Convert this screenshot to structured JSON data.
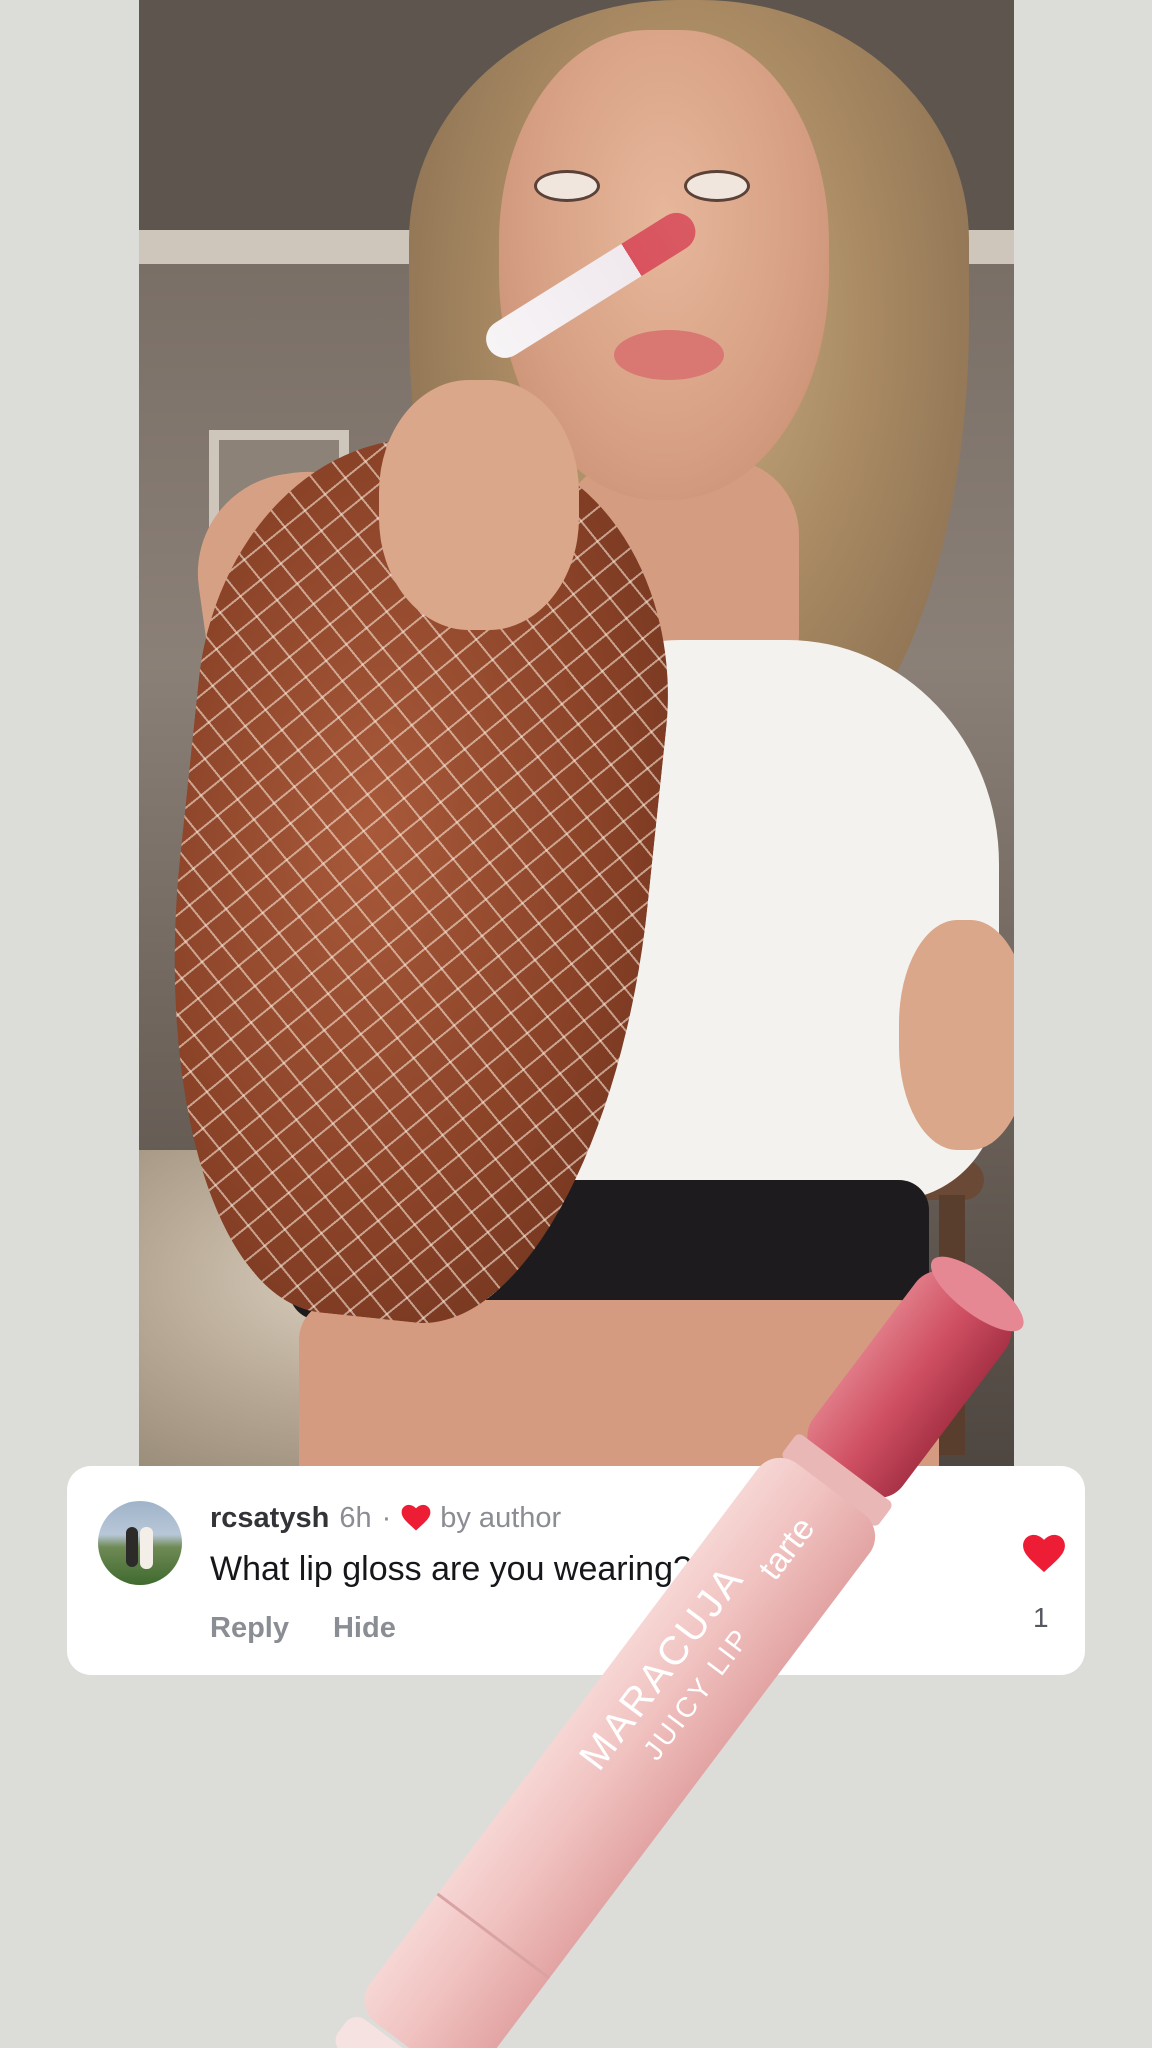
{
  "comment": {
    "username": "rcsatysh",
    "time": "6h",
    "separator": "·",
    "liked_by": "by author",
    "text": "What lip gloss are you wearing?",
    "reply_label": "Reply",
    "hide_label": "Hide",
    "like_count": "1"
  },
  "product": {
    "brand": "tarte",
    "name": "MARACUJA",
    "subname": "JUICY LIP"
  },
  "colors": {
    "heart": "#ee1d36",
    "card": "#ffffff",
    "background": "#dcdcd8"
  },
  "icons": {
    "author_like": "heart-icon",
    "like": "heart-icon"
  }
}
